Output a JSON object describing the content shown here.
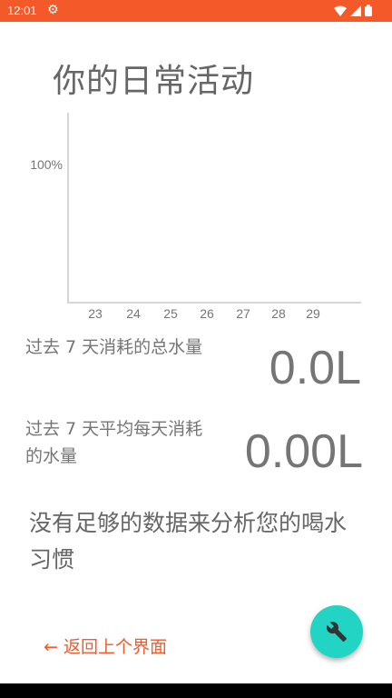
{
  "status_bar": {
    "time": "12:01",
    "settings_icon": "gear-icon",
    "icons": [
      "wifi-icon",
      "signal-icon",
      "battery-icon"
    ],
    "color": "#f4592a"
  },
  "page_title": "你的日常活动",
  "chart_data": {
    "type": "bar",
    "categories": [
      "23",
      "24",
      "25",
      "26",
      "27",
      "28",
      "29"
    ],
    "values": [
      0,
      0,
      0,
      0,
      0,
      0,
      0
    ],
    "ylabel": "",
    "ytick": "100%",
    "ylim": [
      0,
      100
    ],
    "grid": false
  },
  "stats": {
    "total_label": "过去 7 天消耗的总水量",
    "total_value": "0.0L",
    "avg_label_line1": "过去 7 天平均每天消耗",
    "avg_label_line2": "的水量",
    "avg_value": "0.00L"
  },
  "insight": {
    "line1": "没有足够的数据来分析您的喝水",
    "line2": "习惯"
  },
  "back_link": "← 返回上个界面",
  "fab": {
    "icon": "wrench-icon",
    "color": "#21d4c4"
  },
  "accent": "#f4592a"
}
